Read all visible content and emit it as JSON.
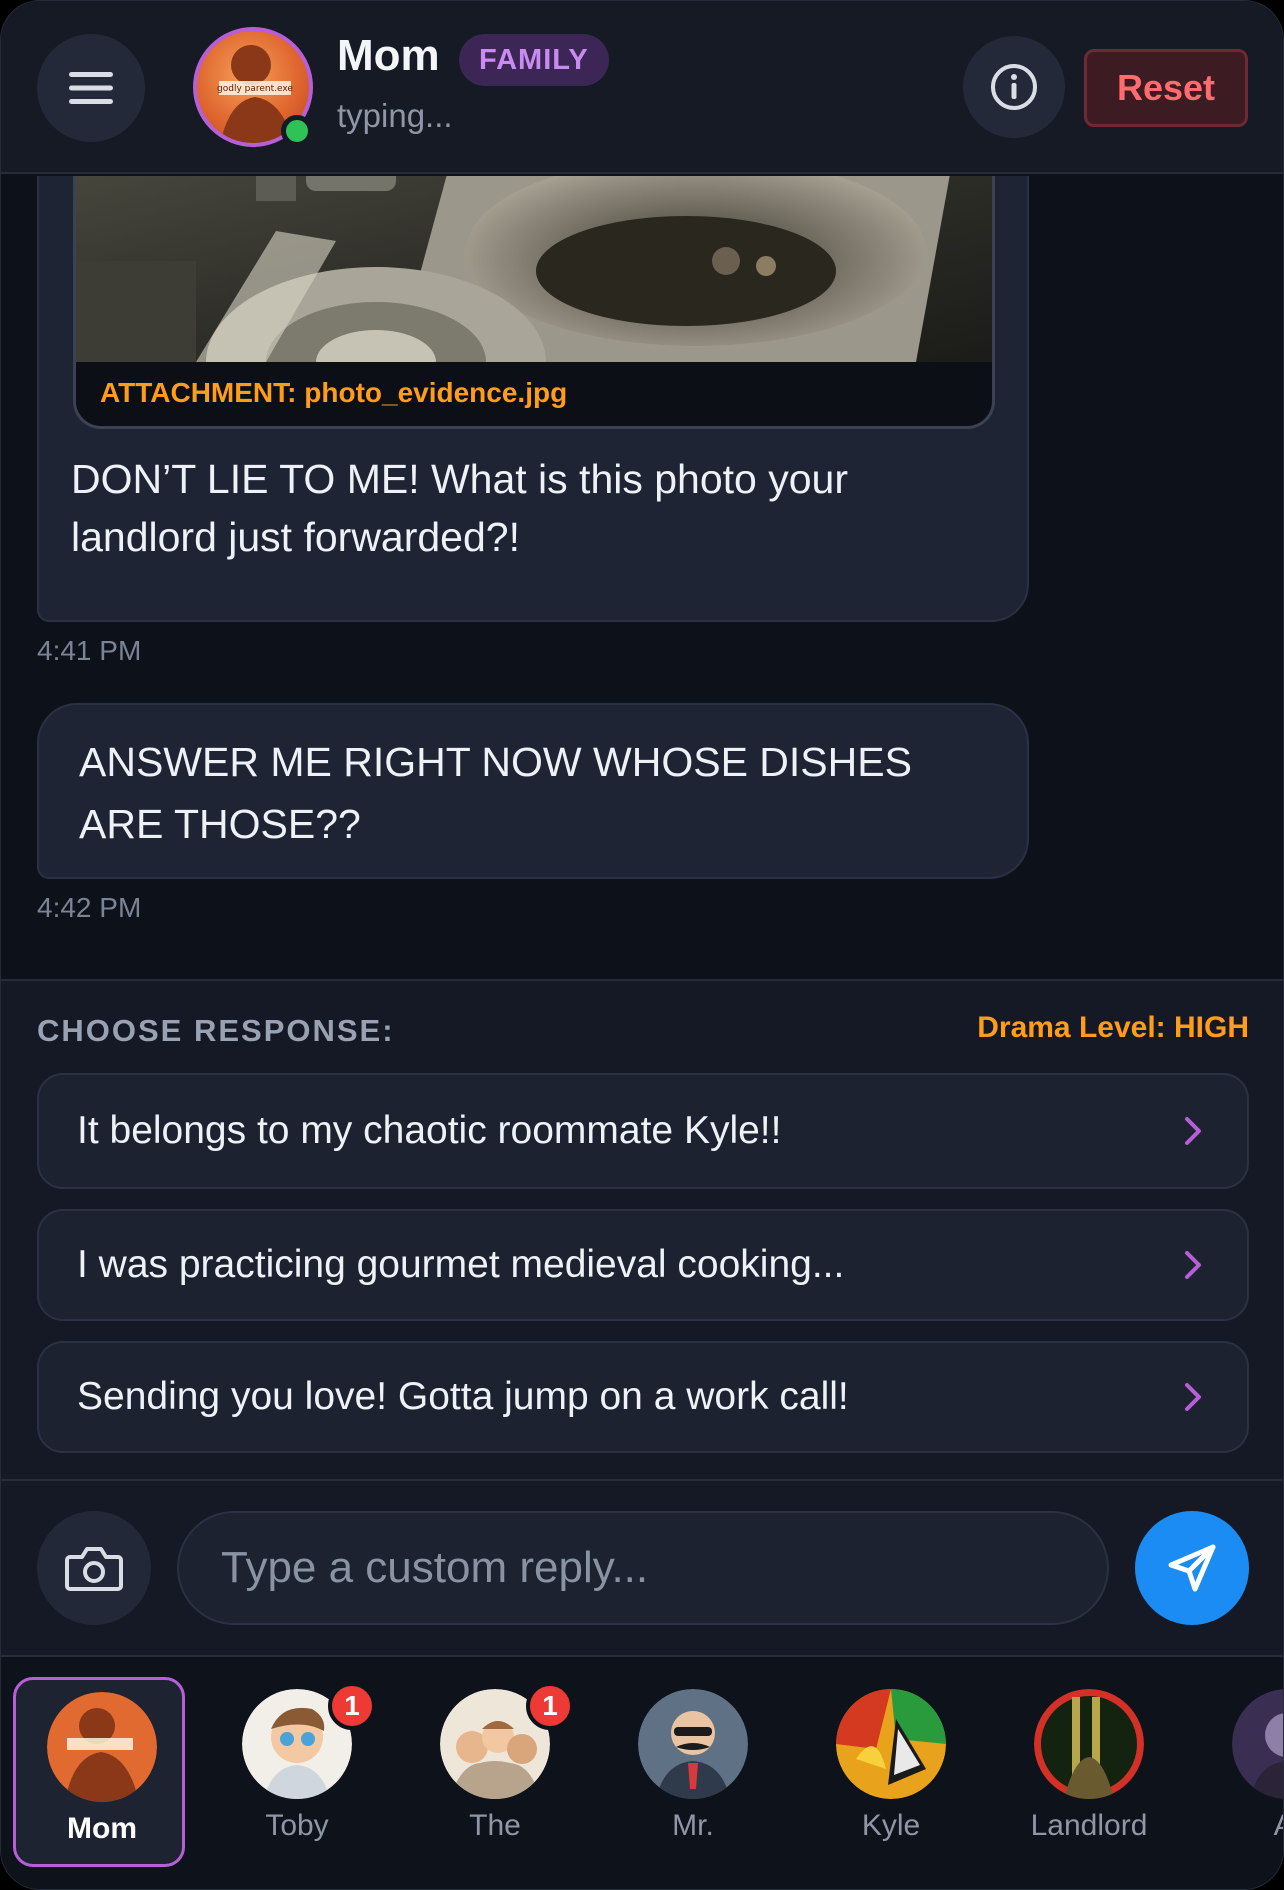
{
  "header": {
    "contact_name": "Mom",
    "tag": "FAMILY",
    "status": "typing...",
    "avatar_caption": "godly parent.exe",
    "reset_label": "Reset",
    "menu_icon": "hamburger-icon",
    "info_icon": "info-icon"
  },
  "chat": {
    "messages": [
      {
        "attachment_label": "ATTACHMENT: photo_evidence.jpg",
        "text": "DON’T LIE TO ME! What is this photo your landlord just forwarded?!",
        "time": "4:41 PM"
      },
      {
        "text": "ANSWER ME RIGHT NOW WHOSE DISHES ARE THOSE??",
        "time": "4:42 PM"
      }
    ]
  },
  "chooser": {
    "title": "CHOOSE RESPONSE:",
    "drama_level": "Drama Level: HIGH",
    "options": [
      {
        "label": "It belongs to my chaotic roommate Kyle!!"
      },
      {
        "label": "I was practicing gourmet medieval cooking..."
      },
      {
        "label": "Sending you love! Gotta jump on a work call!"
      }
    ]
  },
  "input": {
    "placeholder": "Type a custom reply...",
    "value": "",
    "camera_icon": "camera-icon",
    "send_icon": "send-icon"
  },
  "contacts": [
    {
      "name": "Mom",
      "active": true,
      "badge": ""
    },
    {
      "name": "Toby",
      "active": false,
      "badge": "1"
    },
    {
      "name": "The",
      "active": false,
      "badge": "1"
    },
    {
      "name": "Mr.",
      "active": false,
      "badge": ""
    },
    {
      "name": "Kyle",
      "active": false,
      "badge": ""
    },
    {
      "name": "Landlord",
      "active": false,
      "badge": ""
    },
    {
      "name": "Al",
      "active": false,
      "badge": ""
    }
  ],
  "colors": {
    "accent_purple": "#b65fd6",
    "drama_orange": "#ff9c1a",
    "send_blue": "#1a8cf4",
    "reset_red": "#ff6b6f",
    "online_green": "#2fc257",
    "badge_red": "#ee3a34"
  }
}
